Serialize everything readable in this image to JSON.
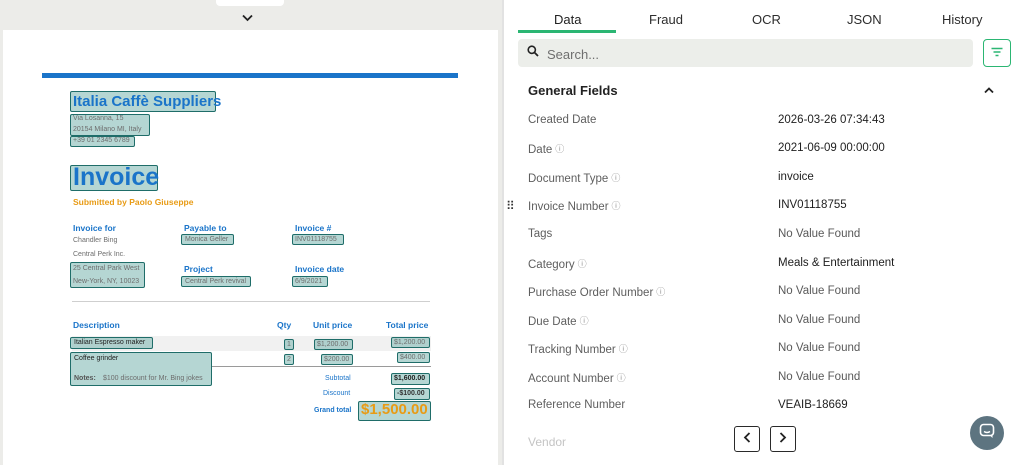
{
  "invoice": {
    "company": "Italia Caffè Suppliers",
    "address1": "Via Losanna, 15",
    "address2": "20154 Milano MI, Italy",
    "phone": "+39 01 2345 6789",
    "title": "Invoice",
    "submitted_by": "Submitted by Paolo Giuseppe",
    "invoice_for_label": "Invoice for",
    "invoice_for_name": "Chandler Bing",
    "invoice_for_company": "Central Perk Inc.",
    "invoice_for_addr1": "25 Central Park West",
    "invoice_for_addr2": "New-York, NY, 10023",
    "payable_to_label": "Payable to",
    "payable_to_value": "Monica Geller",
    "project_label": "Project",
    "project_value": "Central Perk revival",
    "invoice_no_label": "Invoice #",
    "invoice_no_value": "INV01118755",
    "invoice_date_label": "Invoice date",
    "invoice_date_value": "6/9/2021",
    "col_description": "Description",
    "col_qty": "Qty",
    "col_unit_price": "Unit price",
    "col_total_price": "Total price",
    "items": [
      {
        "desc": "Italian Espresso maker",
        "qty": "1",
        "unit": "$1,200.00",
        "total": "$1,200.00"
      },
      {
        "desc": "Coffee grinder",
        "qty": "2",
        "unit": "$200.00",
        "total": "$400.00"
      }
    ],
    "notes_label": "Notes:",
    "notes_value": "$100 discount for Mr. Bing jokes",
    "subtotal_label": "Subtotal",
    "subtotal_value": "$1,600.00",
    "discount_label": "Discount",
    "discount_value": "-$100.00",
    "grand_total_label": "Grand total",
    "grand_total_value": "$1,500.00"
  },
  "tabs": [
    {
      "label": "Data"
    },
    {
      "label": "Fraud"
    },
    {
      "label": "OCR"
    },
    {
      "label": "JSON"
    },
    {
      "label": "History"
    }
  ],
  "search": {
    "placeholder": "Search..."
  },
  "section": {
    "title": "General Fields"
  },
  "fields": [
    {
      "key": "Created Date",
      "value": "2026-03-26 07:34:43"
    },
    {
      "key": "Date",
      "value": "2021-06-09 00:00:00"
    },
    {
      "key": "Document Type",
      "value": "invoice"
    },
    {
      "key": "Invoice Number",
      "value": "INV01118755"
    },
    {
      "key": "Tags",
      "value": "No Value Found"
    },
    {
      "key": "Category",
      "value": "Meals & Entertainment"
    },
    {
      "key": "Purchase Order Number",
      "value": "No Value Found"
    },
    {
      "key": "Due Date",
      "value": "No Value Found"
    },
    {
      "key": "Tracking Number",
      "value": "No Value Found"
    },
    {
      "key": "Account Number",
      "value": "No Value Found"
    },
    {
      "key": "Reference Number",
      "value": "VEAIB-18669"
    }
  ],
  "vendor_label": "Vendor",
  "colors": {
    "accent_green": "#2bb673",
    "doc_blue": "#1a74c9",
    "doc_orange": "#e89b15"
  }
}
